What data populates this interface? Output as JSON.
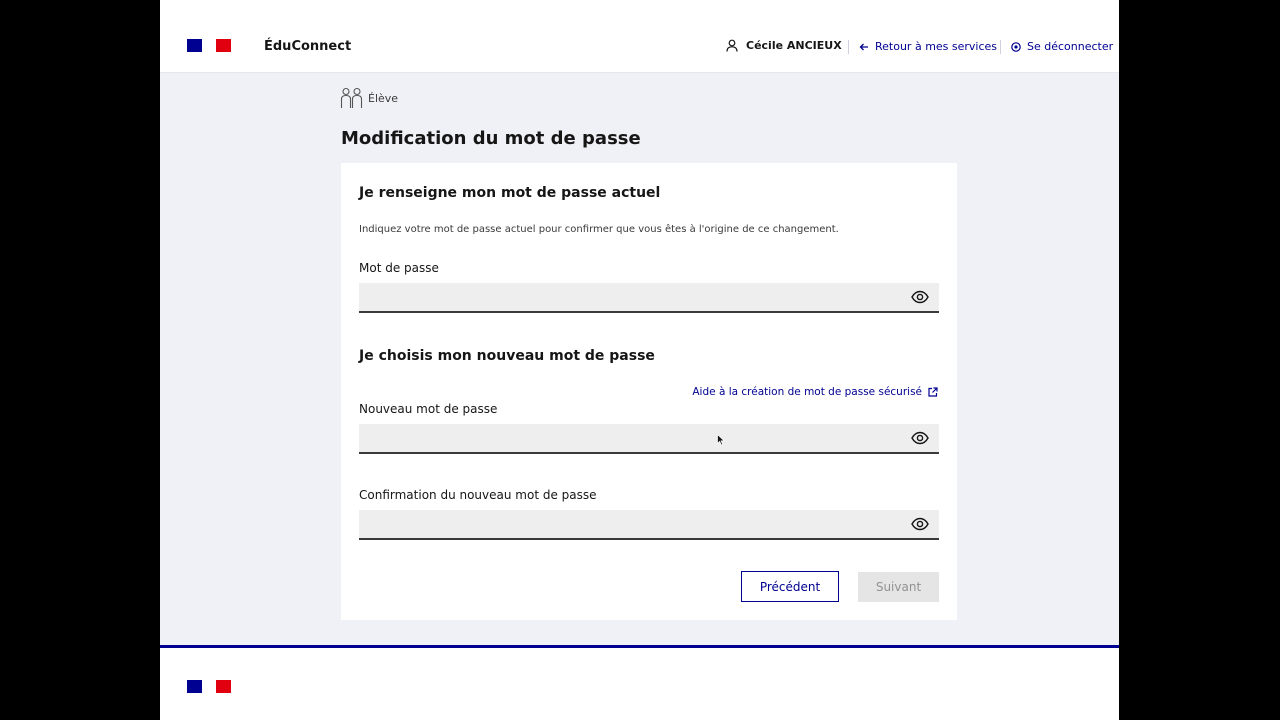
{
  "header": {
    "app_name": "ÉduConnect",
    "user_name": "Cécile ANCIEUX",
    "back_link": "Retour à mes services",
    "logout_link": "Se déconnecter"
  },
  "profile": {
    "label": "Élève",
    "icon": "students-icon"
  },
  "page": {
    "title": "Modification du mot de passe"
  },
  "current_section": {
    "title": "Je renseigne mon mot de passe actuel",
    "hint": "Indiquez votre mot de passe actuel pour confirmer que vous êtes à l'origine de ce changement.",
    "password_label": "Mot de passe",
    "password_value": ""
  },
  "new_section": {
    "title": "Je choisis mon nouveau mot de passe",
    "help_link": "Aide à la création de mot de passe sécurisé",
    "new_label": "Nouveau mot de passe",
    "new_value": "",
    "confirm_label": "Confirmation du nouveau mot de passe",
    "confirm_value": ""
  },
  "buttons": {
    "previous": "Précédent",
    "next": "Suivant"
  },
  "colors": {
    "accent": "#000091",
    "background": "#f0f0f7",
    "flag_red": "#e1000f"
  }
}
